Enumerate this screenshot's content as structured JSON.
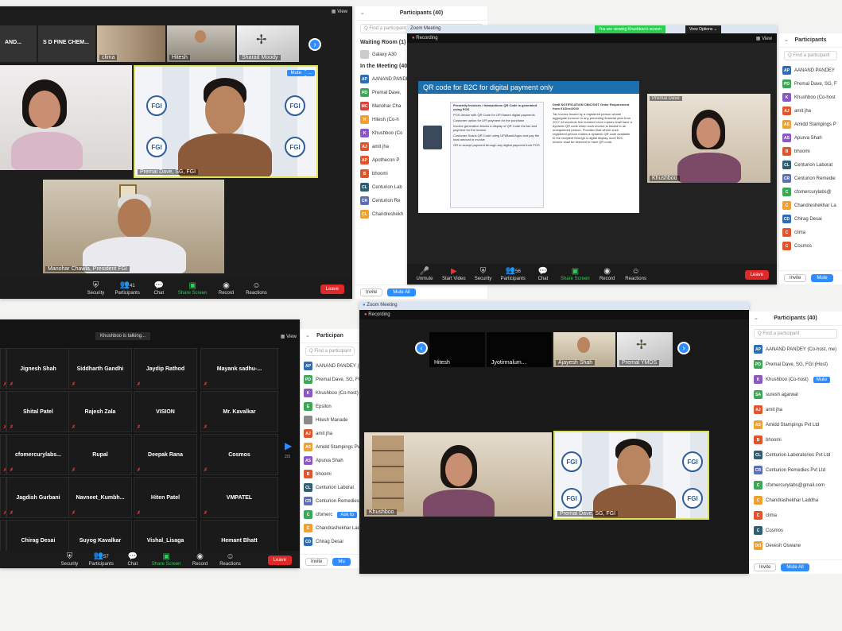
{
  "colors": {
    "accent": "#2d8cff",
    "leave": "#e02828",
    "share": "#2fcc55",
    "recording": "#ff5a5a"
  },
  "s1": {
    "view_label": "View",
    "top_tiles": [
      "AND...",
      "S D FINE CHEM...",
      "clima",
      "Hitesh",
      "Sharad Moody"
    ],
    "presenter": "Premal Dave, SG, FGI",
    "mute_label": "Mute",
    "bottom_tile": "Manohar Chawla, President FGI",
    "toolbar": {
      "security": "Security",
      "participants": "Participants",
      "count": "41",
      "chat": "Chat",
      "share": "Share Screen",
      "record": "Record",
      "reactions": "Reactions",
      "leave": "Leave"
    }
  },
  "s1panel": {
    "title": "Participants (40)",
    "search": "Q Find a participant",
    "waiting": "Waiting Room (1)",
    "waiting_person": {
      "init": "",
      "name": "Galaxy A30"
    },
    "in_meeting": "In the Meeting (40)",
    "rows": [
      {
        "init": "AP",
        "name": "AANAND PANDEY",
        "color": "#2d6db5"
      },
      {
        "init": "PD",
        "name": "Premal Dave,",
        "color": "#3aa857"
      },
      {
        "init": "MC",
        "name": "Manohar Cha",
        "color": "#d9433b"
      },
      {
        "init": "H",
        "name": "Hitesh (Co-h",
        "color": "#f0a030"
      },
      {
        "init": "K",
        "name": "Khushboo (Co",
        "color": "#8a57c4"
      },
      {
        "init": "AJ",
        "name": "amit jha",
        "color": "#e0552c"
      },
      {
        "init": "AP",
        "name": "Apothecon P",
        "color": "#e0552c"
      },
      {
        "init": "B",
        "name": "bhoomi",
        "color": "#e0552c"
      },
      {
        "init": "CL",
        "name": "Centurion Lab",
        "color": "#2f5e72"
      },
      {
        "init": "CR",
        "name": "Centurion Re",
        "color": "#5a6fb8"
      },
      {
        "init": "CL",
        "name": "Chandreshekh",
        "color": "#f0a030"
      }
    ],
    "invite": "Invite",
    "mute_all": "Mute All"
  },
  "s2": {
    "titlebar": "Zoom Meeting",
    "banner": "You are viewing Khushboo's screen",
    "view_options": "View Options ⌄",
    "recording": "Recording",
    "view_label": "View",
    "slide_title": "QR code for B2C for digital payment only",
    "slide_box1_head": "Presently Invoices / transactions QR Code is generated using POS",
    "slide_box1_items": [
      "POS device with QR Code for UPI based digital payments",
      "Customer option for UPI payment for the purchase",
      "Invoice generation blocks a display of QR Code the tax and payment for the invoice",
      "Customer Scans QR Code using UPI/Bank/Apps and pay the total amount in invoice",
      "OR to accept payment through any digital payment from POS"
    ],
    "slide_box2_head": "Draft NOTIFICATION CBIC/GST Order Requirement from 01/Dec/2020",
    "slide_box2_text": "Tax invoice issued by a registered person whose aggregate turnover in any preceding financial year from 2017-18 exceeds five hundred crore rupees shall have a dynamic QR code when such invoice is issued to an unregistered person. Provided that where such registered person makes a dynamic QR code available to the recipient through a digital display, such B2C invoice shall be deemed to have QR code.",
    "cam_label": "Premal Dave",
    "cam2_label": "Khushboo",
    "toolbar": {
      "unmute": "Unmute",
      "start_video": "Start Video",
      "security": "Security",
      "participants": "Participants",
      "count": "56",
      "chat": "Chat",
      "share": "Share Screen",
      "record": "Record",
      "reactions": "Reactions",
      "leave": "Leave"
    }
  },
  "s2panel": {
    "title": "Participants",
    "search": "Q Find a participant",
    "rows": [
      {
        "init": "AP",
        "name": "AANAND PANDEY",
        "color": "#2d6db5"
      },
      {
        "init": "PD",
        "name": "Premal Dave, SG, F",
        "color": "#3aa857"
      },
      {
        "init": "K",
        "name": "Khushboo (Co-host",
        "color": "#8a57c4"
      },
      {
        "init": "AJ",
        "name": "amit jha",
        "color": "#e0552c"
      },
      {
        "init": "AS",
        "name": "Amidd Stampings P",
        "color": "#f0a030"
      },
      {
        "init": "AS",
        "name": "Apurva Shah",
        "color": "#8a57c4"
      },
      {
        "init": "B",
        "name": "bhoomi",
        "color": "#e0552c"
      },
      {
        "init": "CL",
        "name": "Centurion Laborat",
        "color": "#2f5e72"
      },
      {
        "init": "CR",
        "name": "Centurion Remedie",
        "color": "#5a6fb8"
      },
      {
        "init": "C",
        "name": "cfomercurylabs@",
        "color": "#3aa857"
      },
      {
        "init": "C",
        "name": "Chandreshekhar La",
        "color": "#f0a030"
      },
      {
        "init": "CD",
        "name": "Chirag Desai",
        "color": "#2d6db5"
      },
      {
        "init": "C",
        "name": "clima",
        "color": "#e0552c"
      },
      {
        "init": "C",
        "name": "Cosmos",
        "color": "#e0552c"
      }
    ],
    "invite": "Invite",
    "mute_all": "Mute"
  },
  "s3": {
    "talking": "Khushboo is talking...",
    "view_label": "View",
    "grid": [
      [
        "",
        "Jignesh Shah",
        "Siddharth Gandhi",
        "Jaydip Rathod",
        "Mayank sadhu-..."
      ],
      [
        "",
        "Shital Patel",
        "Rajesh Zala",
        "VISION",
        "Mr. Kavalkar"
      ],
      [
        "",
        "cfomercurylabs...",
        "Rupal",
        "Deepak Rana",
        "Cosmos"
      ],
      [
        "",
        "Jagdish Gurbani",
        "Navneet_Kumbh...",
        "Hiten Patel",
        "VMPATEL"
      ],
      [
        "",
        "Chirag Desai",
        "Suyog Kavalkar",
        "Vishal_Lisaga",
        "Hemant Bhatt"
      ]
    ],
    "page": "2/3",
    "toolbar": {
      "security": "Security",
      "participants": "Participants",
      "count": "57",
      "chat": "Chat",
      "share": "Share Screen",
      "record": "Record",
      "reactions": "Reactions",
      "leave": "Leave"
    }
  },
  "s3panel": {
    "title": "Participan",
    "search": "Q Find a participant",
    "rows": [
      {
        "init": "AP",
        "name": "AANAND PANDEY (H",
        "color": "#2d6db5"
      },
      {
        "init": "PD",
        "name": "Premal Dave, SG, FG",
        "color": "#3aa857"
      },
      {
        "init": "K",
        "name": "Khushboo (Co-host)",
        "color": "#8a57c4"
      },
      {
        "init": "E",
        "name": "Epsilon",
        "color": "#3aa857"
      },
      {
        "init": "",
        "name": "Hitesh Manade",
        "color": "#8a8a8a"
      },
      {
        "init": "AJ",
        "name": "amit jha",
        "color": "#e0552c"
      },
      {
        "init": "AS",
        "name": "Amidd Stampings Pv",
        "color": "#f0a030"
      },
      {
        "init": "AS",
        "name": "Apurva Shah",
        "color": "#8a57c4"
      },
      {
        "init": "B",
        "name": "bhoomi",
        "color": "#e0552c"
      },
      {
        "init": "CL",
        "name": "Centurion Laborat",
        "color": "#2f5e72"
      },
      {
        "init": "CR",
        "name": "Centurion Remedies",
        "color": "#5a6fb8"
      },
      {
        "init": "C",
        "name": "cfomerc",
        "color": "#3aa857"
      },
      {
        "init": "C",
        "name": "Chandrashekhar Lad",
        "color": "#f0a030"
      },
      {
        "init": "CD",
        "name": "Chirag Desai",
        "color": "#2d6db5"
      }
    ],
    "ask_unmute": "Ask to",
    "invite": "Invite",
    "mute_all": "Mu"
  },
  "s4": {
    "titlebar": "Zoom Meeting",
    "recording": "Recording",
    "top_tiles": [
      "Hitesh",
      "Jyotirmalum...",
      "Ajayesh Shah",
      "Premal YMDS"
    ],
    "left_tile": "Khushboo",
    "right_tile": "Premal Dave, SG, FGI"
  },
  "s4panel": {
    "title": "Participants (40)",
    "search": "Q Find a participant",
    "rows": [
      {
        "init": "AP",
        "name": "AANAND PANDEY (Co-host, me)",
        "color": "#2d6db5"
      },
      {
        "init": "PD",
        "name": "Premal Dave, SG, FGI (Host)",
        "color": "#3aa857"
      },
      {
        "init": "K",
        "name": "Khushboo (Co-host)",
        "color": "#8a57c4",
        "mute": "Mute"
      },
      {
        "init": "SA",
        "name": "suresh agarwal",
        "color": "#3aa857"
      },
      {
        "init": "AJ",
        "name": "amit jha",
        "color": "#e0552c"
      },
      {
        "init": "AS",
        "name": "Amidd Stampings Pvt Ltd",
        "color": "#f0a030"
      },
      {
        "init": "B",
        "name": "bhoomi",
        "color": "#e0552c"
      },
      {
        "init": "CL",
        "name": "Centurion Laboratories Pvt Ltd",
        "color": "#2f5e72"
      },
      {
        "init": "CR",
        "name": "Centurion Remedies Pvt Ltd",
        "color": "#5a6fb8"
      },
      {
        "init": "C",
        "name": "cfomercurylabs@gmail.com",
        "color": "#3aa857"
      },
      {
        "init": "C",
        "name": "Chandrashekhar Laddha",
        "color": "#f0a030"
      },
      {
        "init": "C",
        "name": "clima",
        "color": "#e0552c"
      },
      {
        "init": "C",
        "name": "Cosmos",
        "color": "#2f5e72"
      },
      {
        "init": "DO",
        "name": "Devesh Oswane",
        "color": "#f0a030"
      }
    ],
    "invite": "Invite",
    "mute_all": "Mute All"
  }
}
